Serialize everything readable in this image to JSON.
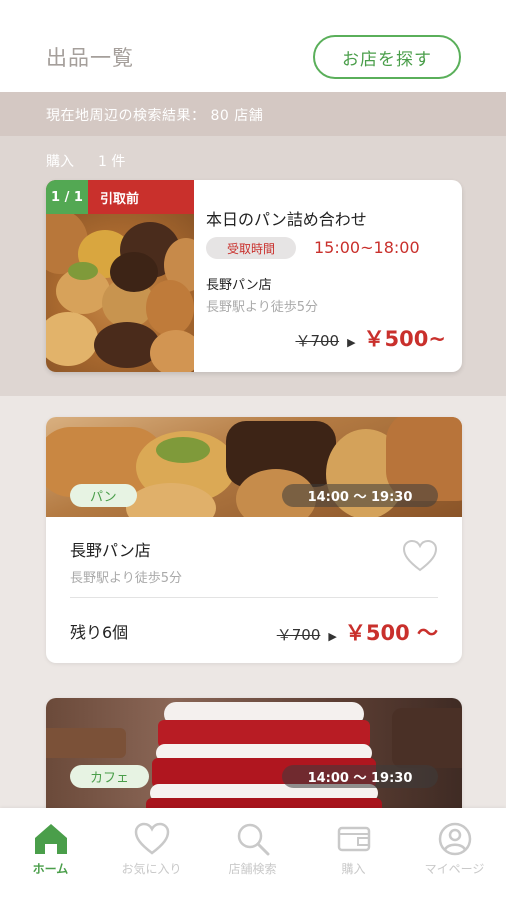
{
  "header": {
    "title": "出品一覧",
    "find_button": "お店を探す"
  },
  "search_result": {
    "text": "現在地周辺の検索結果： 80 店舗"
  },
  "purchases": {
    "label": "購入",
    "count": "1 件",
    "card": {
      "badge_count": "1 / 1",
      "badge_status": "引取前",
      "name": "本日のパン詰め合わせ",
      "time_label": "受取時間",
      "time": "15:00~18:00",
      "shop": "長野パン店",
      "station": "長野駅より徒歩5分",
      "old_price": "￥700",
      "new_price": "￥500~"
    }
  },
  "shops": [
    {
      "category": "パン",
      "hours": "14:00 〜 19:30",
      "name": "長野パン店",
      "station": "長野駅より徒歩5分",
      "remaining": "残り6個",
      "old_price": "￥700",
      "new_price": "￥500 〜"
    },
    {
      "category": "カフェ",
      "hours": "14:00 〜 19:30"
    }
  ],
  "tabs": [
    {
      "label": "ホーム",
      "icon": "home-icon",
      "active": true
    },
    {
      "label": "お気に入り",
      "icon": "heart-icon",
      "active": false
    },
    {
      "label": "店舗検索",
      "icon": "search-icon",
      "active": false
    },
    {
      "label": "購入",
      "icon": "wallet-icon",
      "active": false
    },
    {
      "label": "マイページ",
      "icon": "user-icon",
      "active": false
    }
  ],
  "colors": {
    "accent_green": "#4a9e4a",
    "accent_red": "#c9302c",
    "background": "#ece7e4"
  }
}
